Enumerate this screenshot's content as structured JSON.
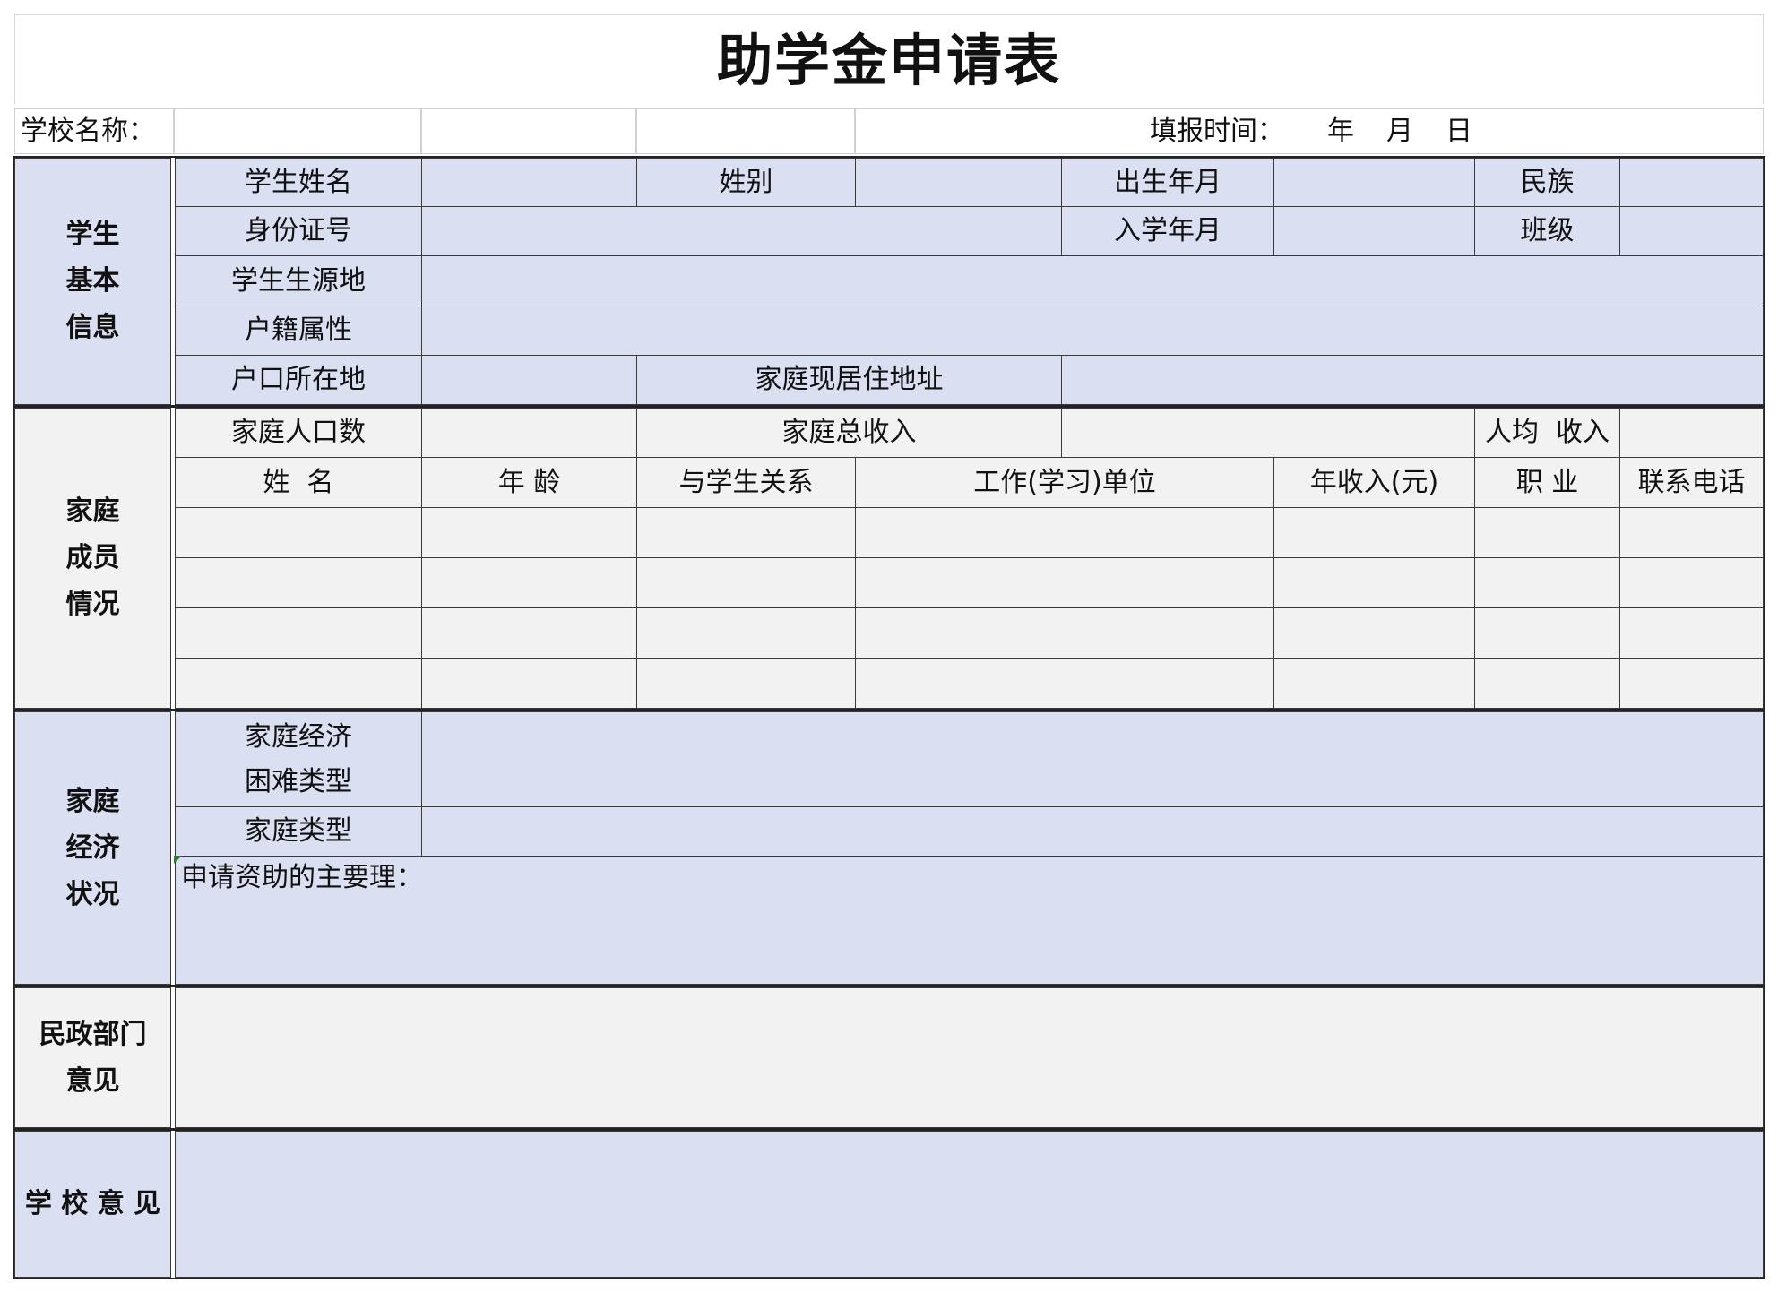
{
  "title": "助学金申请表",
  "header": {
    "school_label": "学校名称：",
    "date_label": "填报时间：",
    "year": "年",
    "month": "月",
    "day": "日"
  },
  "sections": {
    "basic": {
      "heading_lines": [
        "学生",
        "基本",
        "信息"
      ],
      "labels": {
        "name": "学生姓名",
        "gender": "姓别",
        "birth": "出生年月",
        "ethnicity": "民族",
        "id": "身份证号",
        "enroll": "入学年月",
        "class": "班级",
        "origin": "学生生源地",
        "hukou_type": "户籍属性",
        "hukou_place": "户口所在地",
        "address": "家庭现居住地址"
      }
    },
    "family": {
      "heading_lines": [
        "家庭",
        "成员",
        "情况"
      ],
      "labels": {
        "population": "家庭人口数",
        "total_income": "家庭总收入",
        "per_capita": "人均  收入"
      },
      "columns": [
        "姓  名",
        "年 龄",
        "与学生关系",
        "工作(学习)单位",
        "年收入(元)",
        "职 业",
        "联系电话"
      ]
    },
    "economy": {
      "heading_lines": [
        "家庭",
        "经济",
        "状况"
      ],
      "labels": {
        "difficulty_line1": "家庭经济",
        "difficulty_line2": "困难类型",
        "family_type": "家庭类型",
        "reason": "申请资助的主要理："
      }
    },
    "civil": {
      "heading_lines": [
        "民政部门",
        "意见"
      ]
    },
    "school": {
      "heading": "学 校 意 见"
    }
  },
  "colors": {
    "blue_fill": "#dadff2",
    "gray_fill": "#f2f2f2",
    "border": "#3a3a3a"
  }
}
